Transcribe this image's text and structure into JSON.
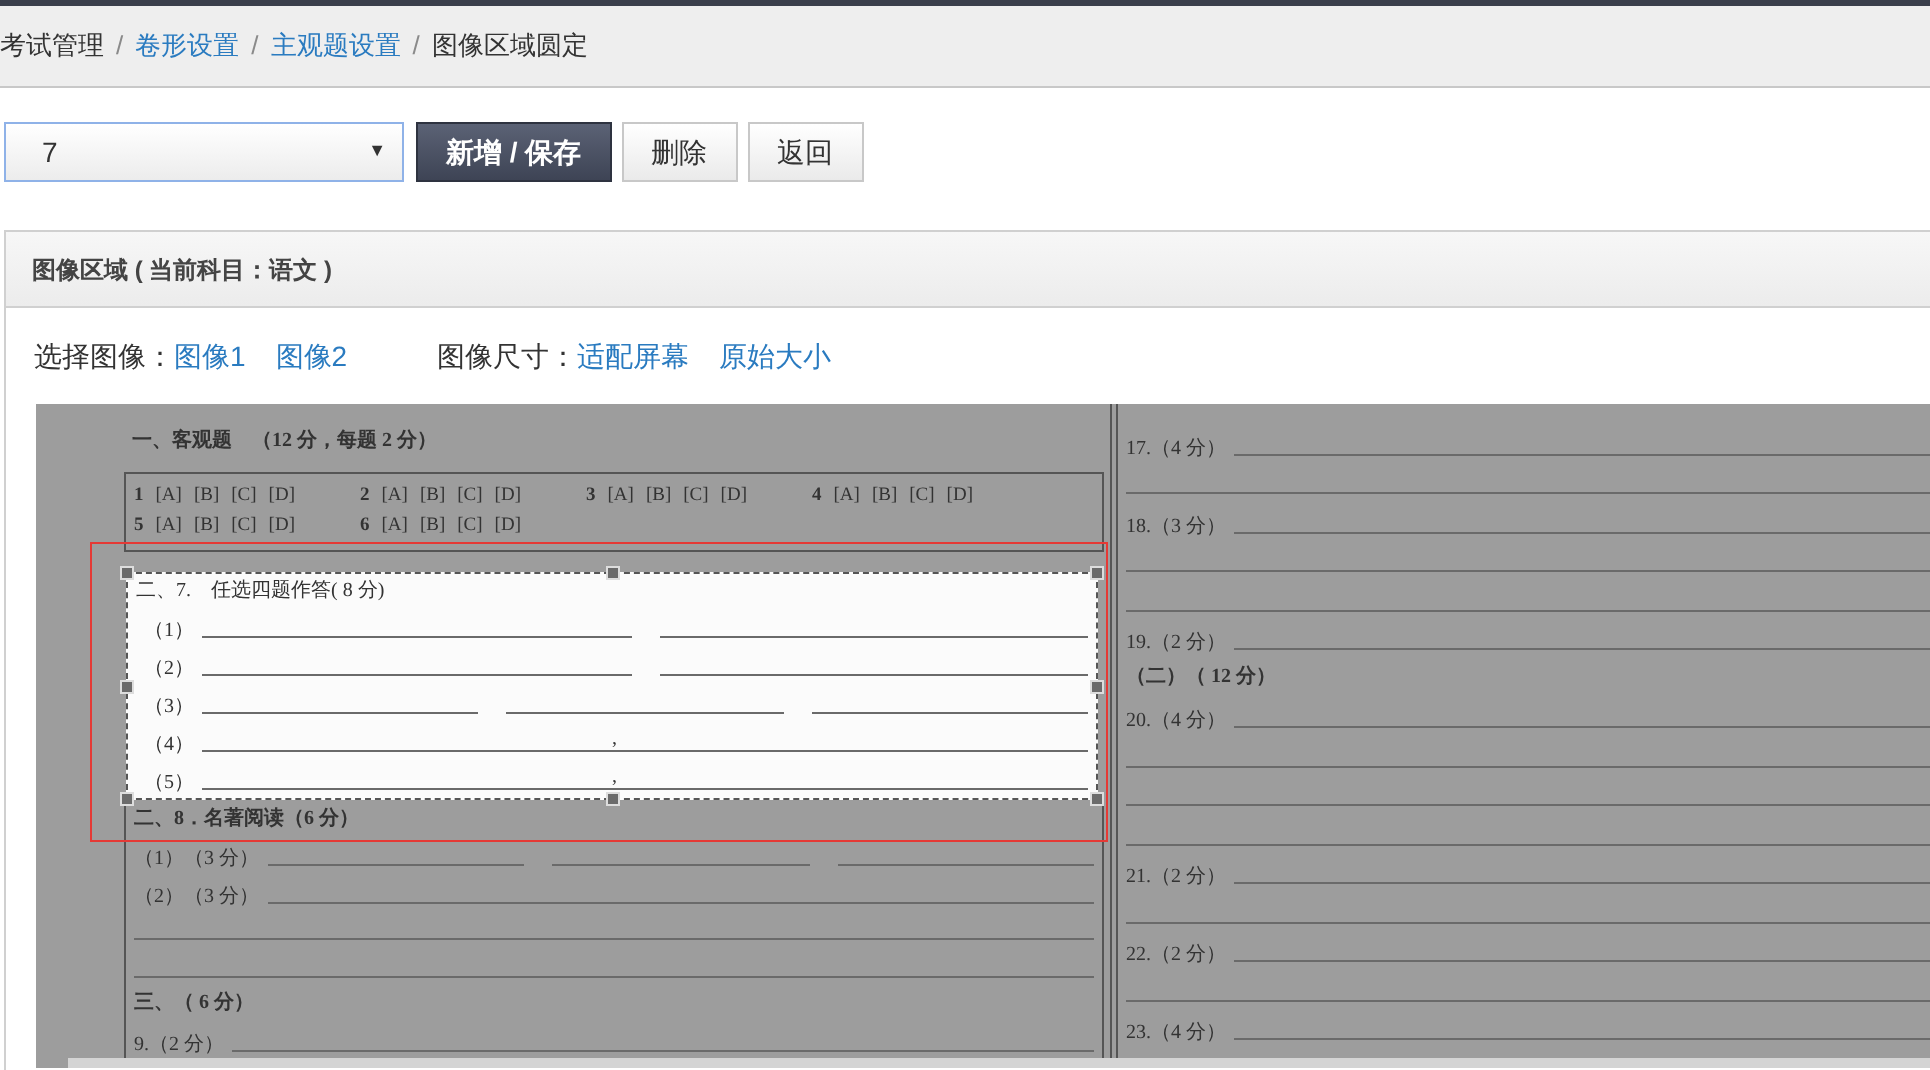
{
  "breadcrumb": {
    "separator": "/",
    "items": [
      {
        "label": "考试管理",
        "link": false
      },
      {
        "label": "卷形设置",
        "link": true
      },
      {
        "label": "主观题设置",
        "link": true
      },
      {
        "label": "图像区域圆定",
        "link": false
      }
    ]
  },
  "question_select": {
    "value": "7",
    "caret": "▼"
  },
  "buttons": [
    {
      "label": "新增 / 保存",
      "kind": "primary"
    },
    {
      "label": "删除",
      "kind": "default"
    },
    {
      "label": "返回",
      "kind": "default"
    }
  ],
  "panel": {
    "title": "图像区域 ( 当前科目：语文 )",
    "image_choice": {
      "label": "选择图像：",
      "options": [
        "图像1",
        "图像2"
      ]
    },
    "image_size": {
      "label": "图像尺寸：",
      "options": [
        "适配屏幕",
        "原始大小"
      ]
    }
  },
  "scan": {
    "objective": {
      "heading": "一、客观题　（12 分，每题 2 分）",
      "rows": [
        [
          {
            "number": "1",
            "options": [
              "[A]",
              "[B]",
              "[C]",
              "[D]"
            ]
          },
          {
            "number": "2",
            "options": [
              "[A]",
              "[B]",
              "[C]",
              "[D]"
            ]
          },
          {
            "number": "3",
            "options": [
              "[A]",
              "[B]",
              "[C]",
              "[D]"
            ]
          },
          {
            "number": "4",
            "options": [
              "[A]",
              "[B]",
              "[C]",
              "[D]"
            ]
          }
        ],
        [
          {
            "number": "5",
            "options": [
              "[A]",
              "[B]",
              "[C]",
              "[D]"
            ]
          },
          {
            "number": "6",
            "options": [
              "[A]",
              "[B]",
              "[C]",
              "[D]"
            ]
          }
        ]
      ]
    },
    "selected_block": {
      "title": "二、7.　任选四题作答( 8 分)",
      "rows": [
        {
          "label": "（1）",
          "blanks": [
            {
              "kind": "line"
            },
            {
              "kind": "line"
            }
          ]
        },
        {
          "label": "（2）",
          "blanks": [
            {
              "kind": "line"
            },
            {
              "kind": "line"
            }
          ]
        },
        {
          "label": "（3）",
          "blanks": [
            {
              "kind": "line"
            },
            {
              "kind": "line"
            },
            {
              "kind": "line"
            }
          ]
        },
        {
          "label": "（4）",
          "blanks": [
            {
              "kind": "marked_line",
              "mark": ","
            }
          ]
        },
        {
          "label": "（5）",
          "blanks": [
            {
              "kind": "marked_line",
              "mark": ","
            }
          ]
        }
      ]
    },
    "left_rest": [
      {
        "kind": "heading",
        "label": "二、8．名著阅读（6 分）"
      },
      {
        "kind": "question",
        "label": "（1）（3 分）",
        "blanks": [
          {
            "kind": "line"
          },
          {
            "kind": "line"
          },
          {
            "kind": "line"
          }
        ]
      },
      {
        "kind": "question",
        "label": "（2）（3 分）",
        "blanks": [
          {
            "kind": "line"
          }
        ]
      },
      {
        "kind": "line"
      },
      {
        "kind": "line"
      },
      {
        "kind": "heading",
        "label": "三、（ 6 分）"
      },
      {
        "kind": "question",
        "label": "9.（2 分）",
        "blanks": [
          {
            "kind": "line"
          }
        ]
      }
    ],
    "right": [
      {
        "kind": "question",
        "label": "17.（4 分）",
        "blanks": [
          {
            "kind": "line"
          }
        ]
      },
      {
        "kind": "line"
      },
      {
        "kind": "question",
        "label": "18.（3 分）",
        "blanks": [
          {
            "kind": "line"
          }
        ]
      },
      {
        "kind": "line"
      },
      {
        "kind": "line"
      },
      {
        "kind": "question",
        "label": "19.（2 分）",
        "blanks": [
          {
            "kind": "line"
          }
        ]
      },
      {
        "kind": "heading",
        "label": "（二）（ 12 分）"
      },
      {
        "kind": "question",
        "label": "20.（4 分）",
        "blanks": [
          {
            "kind": "line"
          }
        ]
      },
      {
        "kind": "line"
      },
      {
        "kind": "line"
      },
      {
        "kind": "line"
      },
      {
        "kind": "question",
        "label": "21.（2 分）",
        "blanks": [
          {
            "kind": "line"
          }
        ]
      },
      {
        "kind": "line"
      },
      {
        "kind": "question",
        "label": "22.（2 分）",
        "blanks": [
          {
            "kind": "line"
          }
        ]
      },
      {
        "kind": "line"
      },
      {
        "kind": "question",
        "label": "23.（4 分）",
        "blanks": [
          {
            "kind": "line"
          }
        ]
      }
    ]
  }
}
